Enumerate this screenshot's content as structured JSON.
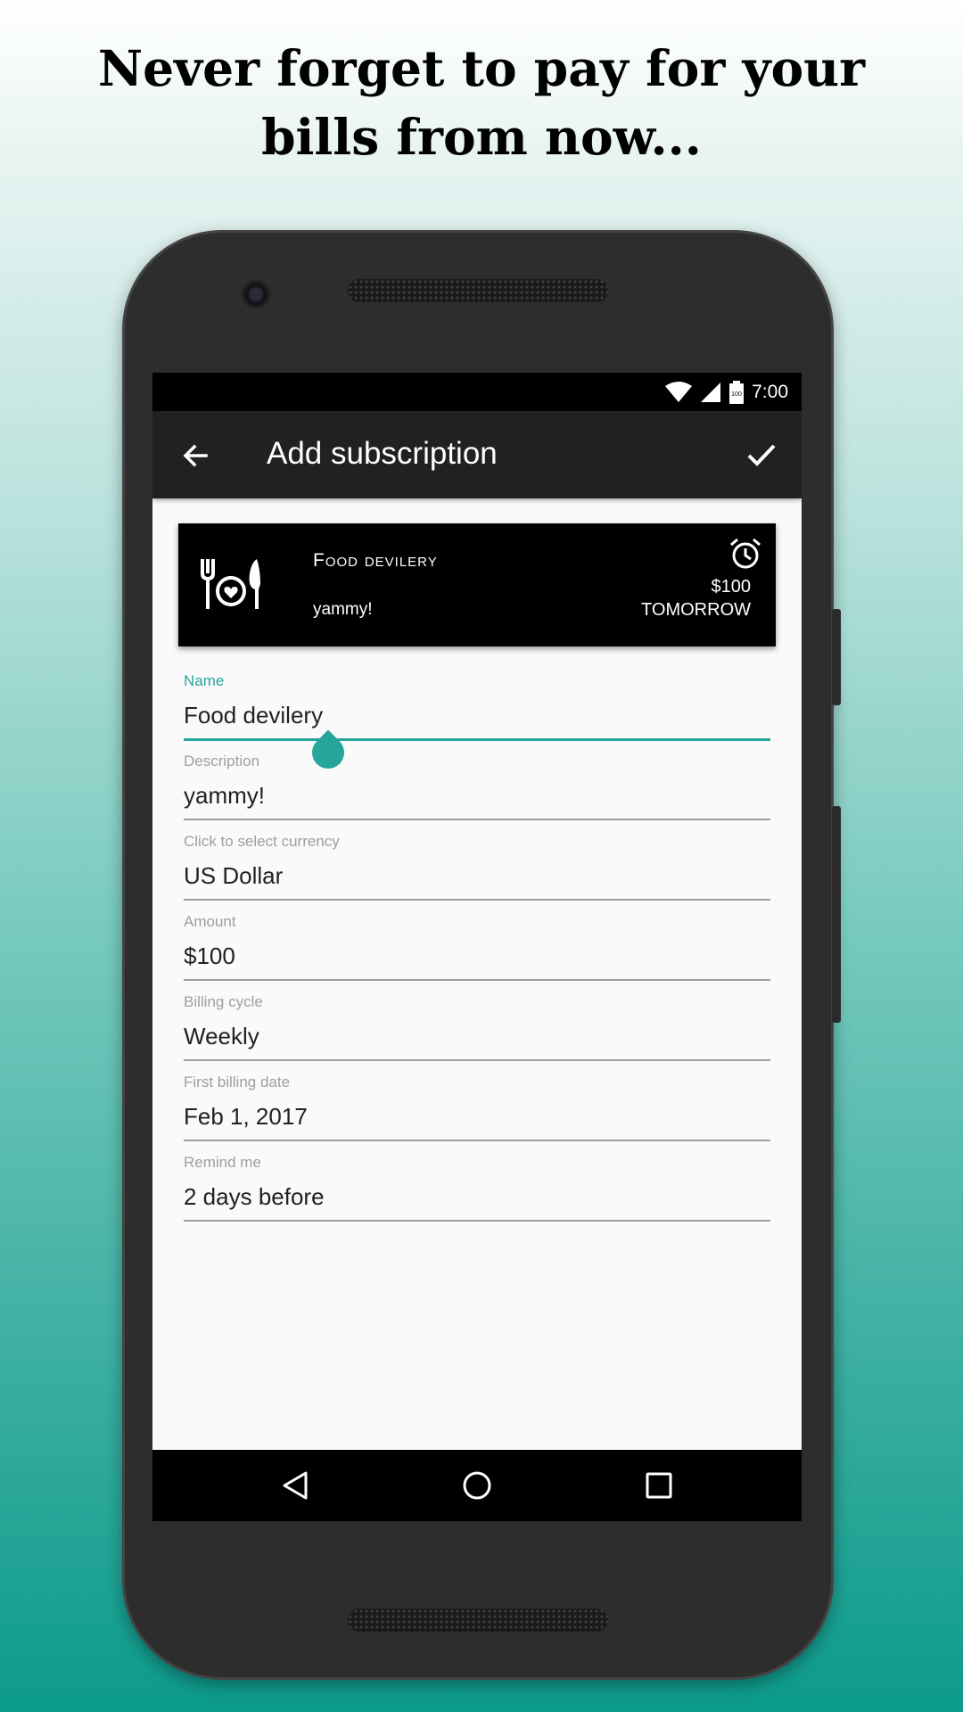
{
  "headline": {
    "line1": "Never forget to pay for your",
    "line2": "bills from now..."
  },
  "status_bar": {
    "time": "7:00",
    "battery_level": "100",
    "icons": [
      "wifi-icon",
      "signal-icon",
      "battery-icon"
    ]
  },
  "app_bar": {
    "title": "Add subscription",
    "back_icon": "arrow-back-icon",
    "confirm_icon": "check-icon"
  },
  "preview_card": {
    "icon": "food-dish-icon",
    "name": "Food devilery",
    "description": "yammy!",
    "alarm_icon": "alarm-clock-icon",
    "amount": "$100",
    "due": "TOMORROW"
  },
  "form": {
    "fields": [
      {
        "label": "Name",
        "value": "Food devilery",
        "focused": true
      },
      {
        "label": "Description",
        "value": "yammy!"
      },
      {
        "label": "Click to select currency",
        "value": "US Dollar"
      },
      {
        "label": "Amount",
        "value": "$100"
      },
      {
        "label": "Billing cycle",
        "value": "Weekly"
      },
      {
        "label": "First billing date",
        "value": "Feb 1, 2017"
      },
      {
        "label": "Remind me",
        "value": "2 days before"
      }
    ]
  },
  "nav_bar": {
    "buttons": [
      "back-triangle-icon",
      "home-circle-icon",
      "recents-square-icon"
    ]
  },
  "colors": {
    "accent": "#26a69a",
    "app_bar": "#212121",
    "card": "#000000",
    "screen_bg": "#fafafa"
  }
}
